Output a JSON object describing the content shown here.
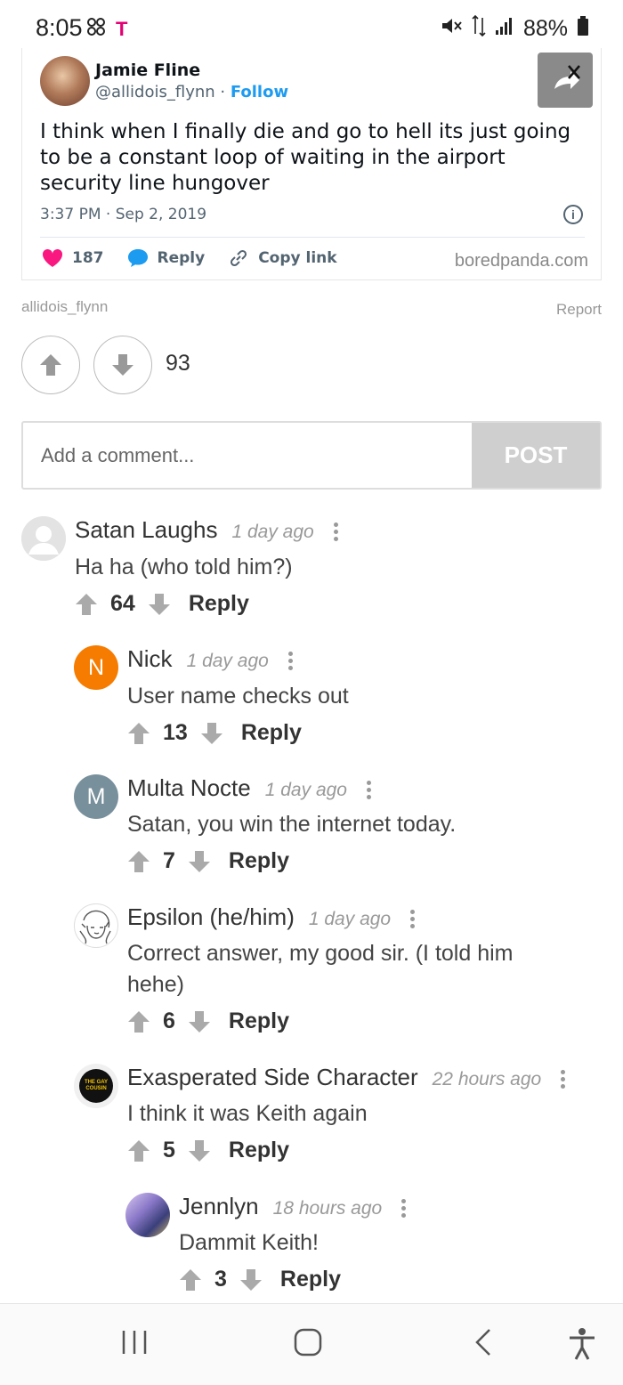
{
  "status_bar": {
    "time": "8:05",
    "carrier": "T",
    "battery": "88%",
    "icons": [
      "pinwheel-icon",
      "mute-icon",
      "data-arrows-icon",
      "signal-icon",
      "battery-icon"
    ]
  },
  "tweet": {
    "name": "Jamie Fline",
    "handle": "@allidois_flynn · ",
    "follow": "Follow",
    "text": "I think when I finally die and go to hell its just going to be a constant loop of waiting in the airport security line hungover",
    "timestamp": "3:37 PM · Sep 2, 2019",
    "likes": "187",
    "reply": "Reply",
    "copy_link": "Copy link",
    "source": "boredpanda.com"
  },
  "post": {
    "attribution": "allidois_flynn",
    "report": "Report",
    "vote_count": "93"
  },
  "comment_form": {
    "placeholder": "Add a comment...",
    "post_label": "POST"
  },
  "comments": [
    {
      "name": "Satan Laughs",
      "time": "1 day ago",
      "text": "Ha ha (who told him?)",
      "votes": "64",
      "reply": "Reply"
    },
    {
      "name": "Nick",
      "time": "1 day ago",
      "text": "User name checks out",
      "votes": "13",
      "reply": "Reply",
      "initial": "N"
    },
    {
      "name": "Multa Nocte",
      "time": "1 day ago",
      "text": "Satan, you win the internet today.",
      "votes": "7",
      "reply": "Reply",
      "initial": "M"
    },
    {
      "name": "Epsilon (he/him)",
      "time": "1 day ago",
      "text": "Correct answer, my good sir. (I told him hehe)",
      "votes": "6",
      "reply": "Reply"
    },
    {
      "name": "Exasperated Side Character",
      "time": "22 hours ago",
      "text": "I think it was Keith again",
      "votes": "5",
      "reply": "Reply",
      "avatar_text": "THE GAY COUSIN"
    },
    {
      "name": "Jennlyn",
      "time": "18 hours ago",
      "text": "Dammit Keith!",
      "votes": "3",
      "reply": "Reply"
    }
  ],
  "colors": {
    "accent_blue": "#1d9bf0",
    "heart": "#f91880",
    "nick_avatar": "#f57c00",
    "multa_avatar": "#78909c",
    "post_disabled": "#cfcfcf"
  }
}
